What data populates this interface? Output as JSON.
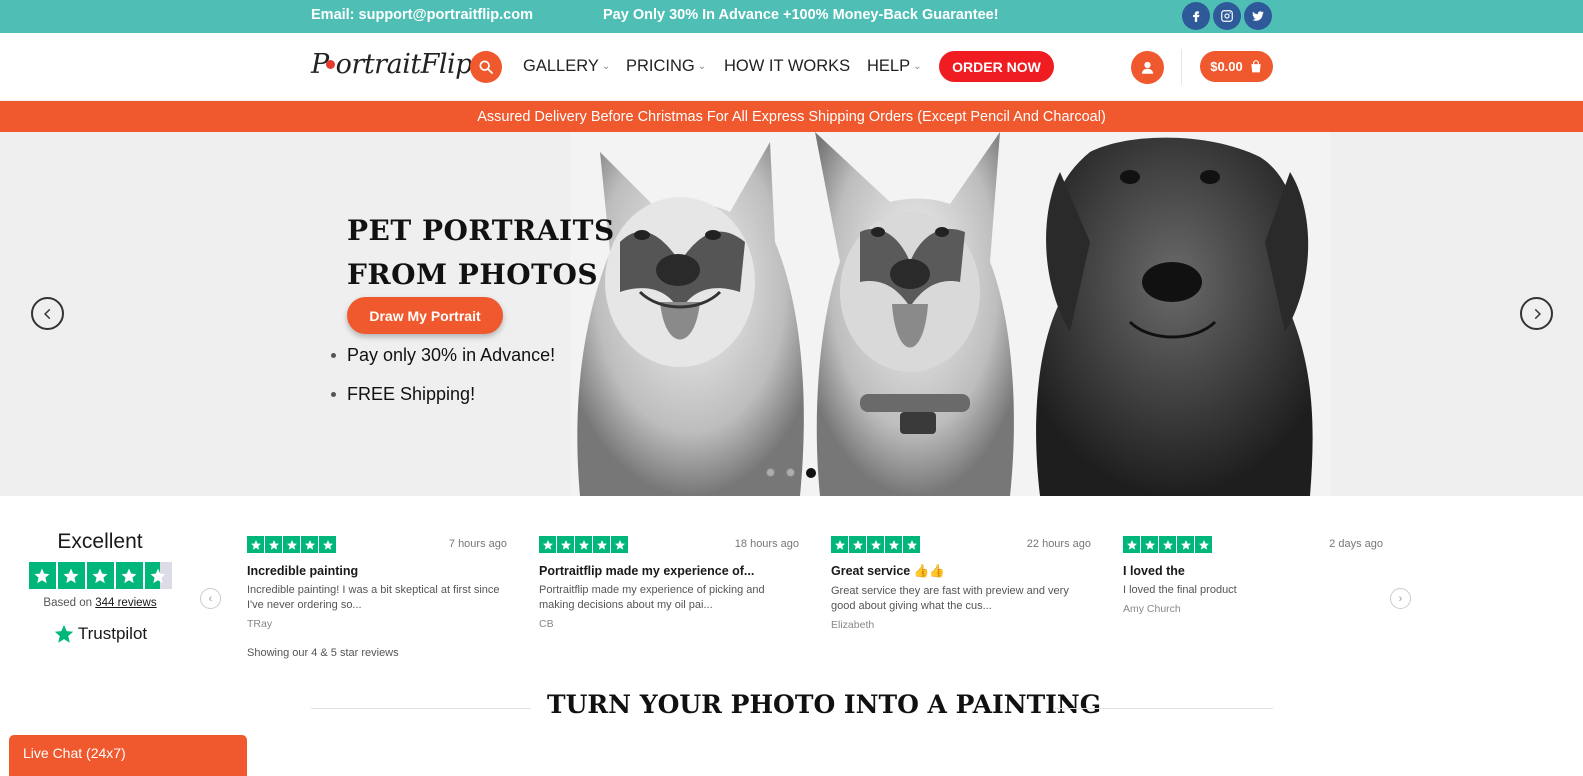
{
  "topbar": {
    "email": "Email: support@portraitflip.com",
    "promo": "Pay Only 30% In Advance +100% Money-Back Guarantee!",
    "social": [
      "facebook-icon",
      "instagram-icon",
      "twitter-icon"
    ],
    "color": "#4fbfb6"
  },
  "header": {
    "logo_text": "PortraitFlip",
    "nav": {
      "gallery": "GALLERY",
      "pricing": "PRICING",
      "how": "HOW IT WORKS",
      "help": "HELP"
    },
    "order_label": "ORDER NOW",
    "cart_label": "$0.00",
    "accent": "#f0582d",
    "order_color": "#ef1c22"
  },
  "notice": "Assured Delivery Before Christmas For All Express Shipping Orders (Except Pencil And Charcoal)",
  "hero": {
    "title_line1": "PET PORTRAITS",
    "title_line2": "FROM PHOTOS",
    "cta": "Draw My Portrait",
    "bullets": [
      "Pay only 30% in Advance!",
      "FREE Shipping!"
    ],
    "slides_total": 3,
    "active_slide": 3
  },
  "trustpilot": {
    "rating_word": "Excellent",
    "based_prefix": "Based on",
    "reviews_count": "344 reviews",
    "brand": "Trustpilot",
    "stars": 4.5,
    "showing": "Showing our 4 & 5 star reviews",
    "reviews": [
      {
        "time": "7 hours ago",
        "title": "Incredible painting",
        "text": "Incredible painting! I was a bit skeptical at first since I've never ordering so...",
        "name": "TRay",
        "stars": 5
      },
      {
        "time": "18 hours ago",
        "title": "Portraitflip made my experience of...",
        "text": "Portraitflip made my experience of picking and making decisions about my oil pai...",
        "name": "CB",
        "stars": 5
      },
      {
        "time": "22 hours ago",
        "title": "Great service 👍👍",
        "text": "Great service they are fast with preview and very good about giving what the cus...",
        "name": "Elizabeth",
        "stars": 5
      },
      {
        "time": "2 days ago",
        "title": "I loved the",
        "text": "I loved the final product",
        "name": "Amy Church",
        "stars": 5
      }
    ]
  },
  "section_title": "TURN YOUR PHOTO INTO A PAINTING",
  "livechat": "Live Chat (24x7)"
}
